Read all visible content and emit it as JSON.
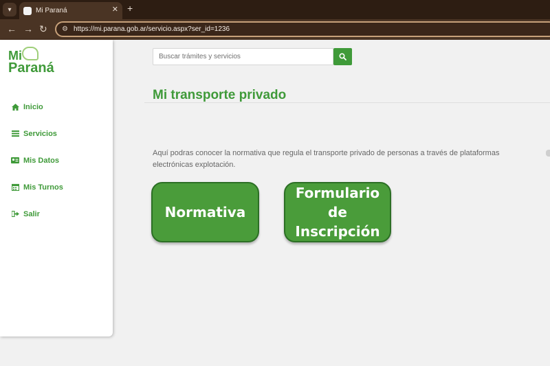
{
  "browser": {
    "tab_title": "Mi Paraná",
    "tab_close": "✕",
    "new_tab": "+",
    "url": "https://mi.parana.gob.ar/servicio.aspx?ser_id=1236"
  },
  "logo": {
    "line1": "Mi",
    "line2": "Paraná"
  },
  "sidebar": {
    "items": [
      {
        "label": "Inicio",
        "icon": "home-icon"
      },
      {
        "label": "Servicios",
        "icon": "list-icon"
      },
      {
        "label": "Mis Datos",
        "icon": "id-card-icon"
      },
      {
        "label": "Mis Turnos",
        "icon": "calendar-icon"
      },
      {
        "label": "Salir",
        "icon": "sign-out-icon"
      }
    ]
  },
  "search": {
    "placeholder": "Buscar trámites y servicios"
  },
  "main": {
    "title": "Mi transporte privado",
    "description": "Aquí podras conocer la normativa que regula el transporte privado de personas a través de plataformas electrónicas explotación.",
    "buttons": [
      {
        "label": "Normativa"
      },
      {
        "label": "Formulario de Inscripción"
      }
    ]
  },
  "colors": {
    "accent": "#3f9a39",
    "button": "#4a9c3a"
  }
}
